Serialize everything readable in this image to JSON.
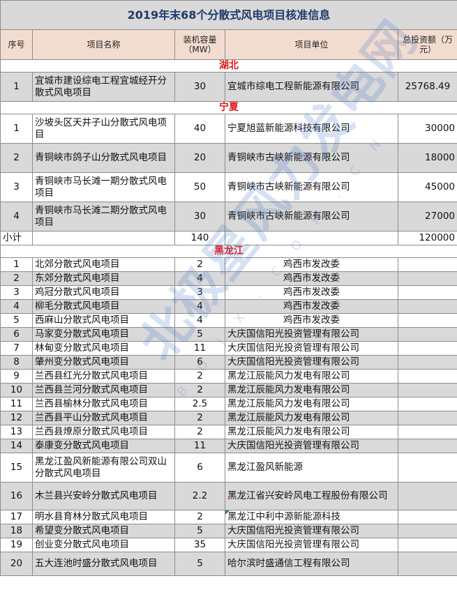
{
  "title": "2019年末68个分散式风电项目核准信息",
  "headers": [
    "序号",
    "项目名称",
    "装机容量（MW）",
    "项目单位",
    "总投资额（万元）"
  ],
  "sections": [
    {
      "name": "湖北",
      "rows": [
        {
          "no": "1",
          "name": "宜城市建设综电工程宜城经开分散式风电项目",
          "cap": "30",
          "org": "宜城市综电工程新能源有限公司",
          "inv": "25768.49"
        }
      ]
    },
    {
      "name": "宁夏",
      "rows": [
        {
          "no": "1",
          "name": "沙坡头区天井子山分散式风电项目",
          "cap": "40",
          "org": "宁夏旭蓝新能源科技有限公司",
          "inv": "30000"
        },
        {
          "no": "2",
          "name": "青铜峡市鸽子山分散式风电项目",
          "cap": "20",
          "org": "青铜峡市古峡新能源有限公司",
          "inv": "18000"
        },
        {
          "no": "3",
          "name": "青铜峡市马长滩一期分散式风电项目",
          "cap": "50",
          "org": "青铜峡市古峡新能源有限公司",
          "inv": "45000"
        },
        {
          "no": "4",
          "name": "青铜峡市马长滩二期分散式风电项目",
          "cap": "30",
          "org": "青铜峡市古峡新能源有限公司",
          "inv": "27000"
        }
      ],
      "subtotal": {
        "label": "小计",
        "cap": "140",
        "inv": "120000"
      }
    },
    {
      "name": "黑龙江",
      "rows": [
        {
          "no": "1",
          "name": "北郊分散式风电项目",
          "cap": "2",
          "org": "鸡西市发改委",
          "inv": ""
        },
        {
          "no": "2",
          "name": "东郊分散式风电项目",
          "cap": "4",
          "org": "鸡西市发改委",
          "inv": ""
        },
        {
          "no": "3",
          "name": "鸡冠分散式风电项目",
          "cap": "3",
          "org": "鸡西市发改委",
          "inv": ""
        },
        {
          "no": "4",
          "name": "柳毛分散式风电项目",
          "cap": "4",
          "org": "鸡西市发改委",
          "inv": ""
        },
        {
          "no": "5",
          "name": "西麻山分散式风电项目",
          "cap": "4",
          "org": "鸡西市发改委",
          "inv": ""
        },
        {
          "no": "6",
          "name": "马家变分散式风电项目",
          "cap": "5",
          "org": "大庆国信阳光投资管理有限公司",
          "inv": ""
        },
        {
          "no": "7",
          "name": "林甸变分散式风电项目",
          "cap": "11",
          "org": "大庆国信阳光投资管理有限公司",
          "inv": ""
        },
        {
          "no": "8",
          "name": "肇州变分散式风电项目",
          "cap": "6",
          "org": "大庆国信阳光投资管理有限公司",
          "inv": ""
        },
        {
          "no": "9",
          "name": "兰西县红光分散式风电项目",
          "cap": "2",
          "org": "黑龙江辰能风力发电有限公司",
          "inv": ""
        },
        {
          "no": "10",
          "name": "兰西县兰河分散式风电项目",
          "cap": "2",
          "org": "黑龙江辰能风力发电有限公司",
          "inv": ""
        },
        {
          "no": "11",
          "name": "兰西县榆林分散式风电项目",
          "cap": "2.5",
          "org": "黑龙江辰能风力发电有限公司",
          "inv": ""
        },
        {
          "no": "12",
          "name": "兰西县平山分散式风电项目",
          "cap": "2",
          "org": "黑龙江辰能风力发电有限公司",
          "inv": ""
        },
        {
          "no": "13",
          "name": "兰西县燎原分散式风电项目",
          "cap": "2",
          "org": "黑龙江辰能风力发电有限公司",
          "inv": ""
        },
        {
          "no": "14",
          "name": "泰康变分散式风电项目",
          "cap": "11",
          "org": "大庆国信阳光投资管理有限公司",
          "inv": ""
        },
        {
          "no": "15",
          "name": "黑龙江盈风新能源有限公司双山分散式风电项目",
          "cap": "6",
          "org": "黑龙江盈风新能源",
          "inv": ""
        },
        {
          "no": "16",
          "name": "木兰县兴安岭分散式风电项目",
          "cap": "2.2",
          "org": "黑龙江省兴安岭风电工程股份有限公司",
          "inv": ""
        },
        {
          "no": "17",
          "name": "明水县育林分散式风电项目",
          "cap": "2",
          "org": "黑龙江中利中源新能源科技",
          "inv": ""
        },
        {
          "no": "18",
          "name": "希望变分散式风电项目",
          "cap": "5",
          "org": "大庆国信阳光投资管理有限公司",
          "inv": ""
        },
        {
          "no": "19",
          "name": "创业变分散式风电项目",
          "cap": "35",
          "org": "大庆国信阳光投资管理有限公司",
          "inv": ""
        },
        {
          "no": "20",
          "name": "五大连池时盛分散式风电项目",
          "cap": "5",
          "org": "哈尔滨时盛通信工程有限公司",
          "inv": ""
        }
      ]
    }
  ],
  "watermark": {
    "text": "北极星风力发电网",
    "sub": "B D J X . C O M . C N"
  }
}
